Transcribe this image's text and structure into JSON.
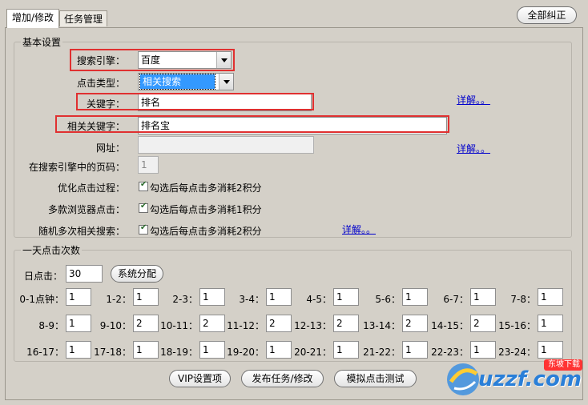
{
  "tabs": [
    {
      "label": "增加/修改",
      "active": true
    },
    {
      "label": "任务管理",
      "active": false
    }
  ],
  "reset_all_label": "全部纠正",
  "basic": {
    "legend": "基本设置",
    "engine_label": "搜索引擎：",
    "engine_value": "百度",
    "click_type_label": "点击类型：",
    "click_type_value": "相关搜索",
    "keyword_label": "关键字：",
    "keyword_value": "排名",
    "related_keyword_label": "相关关键字：",
    "related_keyword_value": "排名宝",
    "url_label": "网址：",
    "url_value": "",
    "page_label": "在搜索引擎中的页码：",
    "page_value": "1",
    "optimize_label": "优化点击过程：",
    "optimize_text": "勾选后每点击多消耗2积分",
    "multi_browser_label": "多款浏览器点击：",
    "multi_browser_text": "勾选后每点击多消耗1积分",
    "random_label": "随机多次相关搜索：",
    "random_text": "勾选后每点击多消耗2积分",
    "detail_link": "详解。。"
  },
  "daily": {
    "legend": "一天点击次数",
    "daily_label": "日点击：",
    "daily_value": "30",
    "system_assign_label": "系统分配",
    "hours": [
      {
        "label": "0-1点钟：",
        "value": "1"
      },
      {
        "label": "1-2：",
        "value": "1"
      },
      {
        "label": "2-3：",
        "value": "1"
      },
      {
        "label": "3-4：",
        "value": "1"
      },
      {
        "label": "4-5：",
        "value": "1"
      },
      {
        "label": "5-6：",
        "value": "1"
      },
      {
        "label": "6-7：",
        "value": "1"
      },
      {
        "label": "7-8：",
        "value": "1"
      },
      {
        "label": "8-9：",
        "value": "1"
      },
      {
        "label": "9-10：",
        "value": "2"
      },
      {
        "label": "10-11：",
        "value": "2"
      },
      {
        "label": "11-12：",
        "value": "2"
      },
      {
        "label": "12-13：",
        "value": "2"
      },
      {
        "label": "13-14：",
        "value": "2"
      },
      {
        "label": "14-15：",
        "value": "2"
      },
      {
        "label": "15-16：",
        "value": "1"
      },
      {
        "label": "16-17：",
        "value": "1"
      },
      {
        "label": "17-18：",
        "value": "1"
      },
      {
        "label": "18-19：",
        "value": "1"
      },
      {
        "label": "19-20：",
        "value": "1"
      },
      {
        "label": "20-21：",
        "value": "1"
      },
      {
        "label": "21-22：",
        "value": "1"
      },
      {
        "label": "22-23：",
        "value": "1"
      },
      {
        "label": "23-24：",
        "value": "1"
      }
    ]
  },
  "bottom": {
    "vip_label": "VIP设置项",
    "publish_label": "发布任务/修改",
    "simulate_label": "模拟点击测试"
  },
  "watermark": {
    "text": "uzzf.com",
    "sub": "东坡下载"
  },
  "colors": {
    "highlight": "#e03030",
    "link": "#0000cc",
    "select_highlight": "#3399ff"
  }
}
